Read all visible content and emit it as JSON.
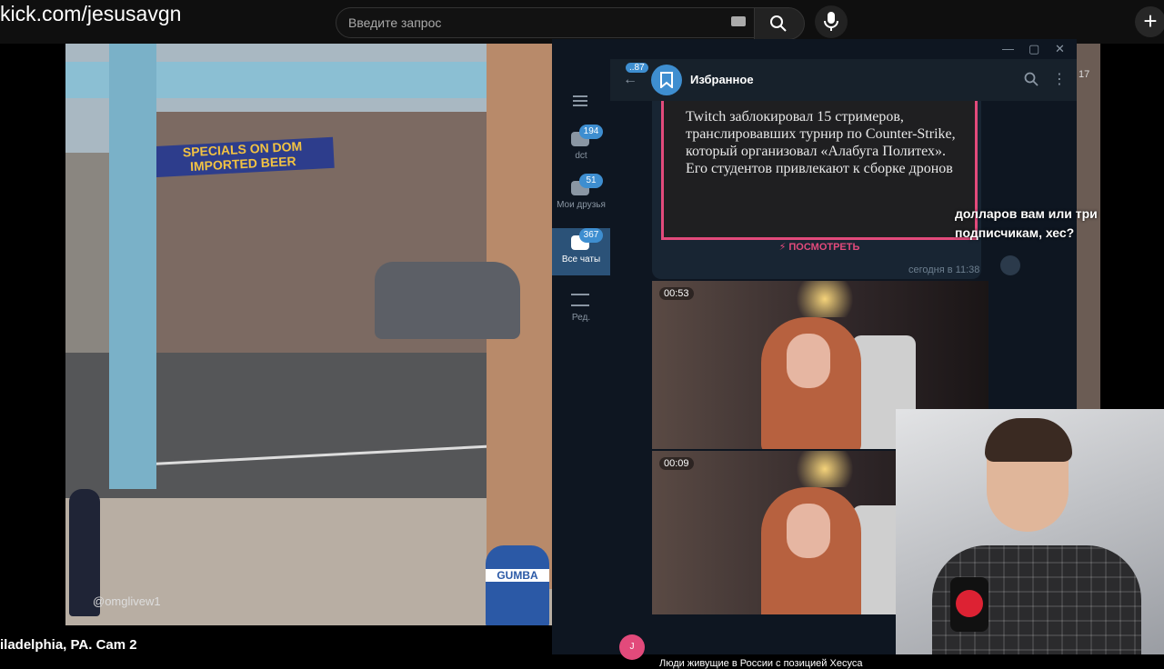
{
  "browser": {
    "url": "kick.com/jesusavgn",
    "search_placeholder": "Введите запрос"
  },
  "stream": {
    "caption": "iladelphia, PA. Cam 2",
    "watermark": "@omglivew1",
    "sign_text": "SPECIALS ON DOM IMPORTED BEER",
    "mailbox_text": "GUMBA"
  },
  "telegram": {
    "back_badge": "..87",
    "chat_title": "Избранное",
    "folders": [
      {
        "label": "dct",
        "badge": "194"
      },
      {
        "label": "Мои друзья",
        "badge": "51"
      },
      {
        "label": "Все чаты",
        "badge": "367"
      },
      {
        "label": "Ред.",
        "badge": ""
      }
    ],
    "post_text": "Twitch заблокировал 15 стримеров, транслировавших турнир по Counter-Strike, который организовал «Алабуга Политех». Его студентов привлекают к сборке дронов",
    "view_button": "⚡ ПОСМОТРЕТЬ",
    "post_time": "сегодня в 11:38",
    "videos": [
      {
        "duration": "00:53"
      },
      {
        "duration": "00:09"
      }
    ],
    "link_preview": "Люди живущие в России с позицией Хесуса",
    "avatar_letter": "J"
  },
  "overlay": {
    "side_number": "17",
    "subtitle": "долларов вам или три подписчикам, хес?"
  },
  "colors": {
    "accent": "#3e8ed0",
    "pink": "#e24a7b",
    "tg_bg": "#0e1621"
  }
}
